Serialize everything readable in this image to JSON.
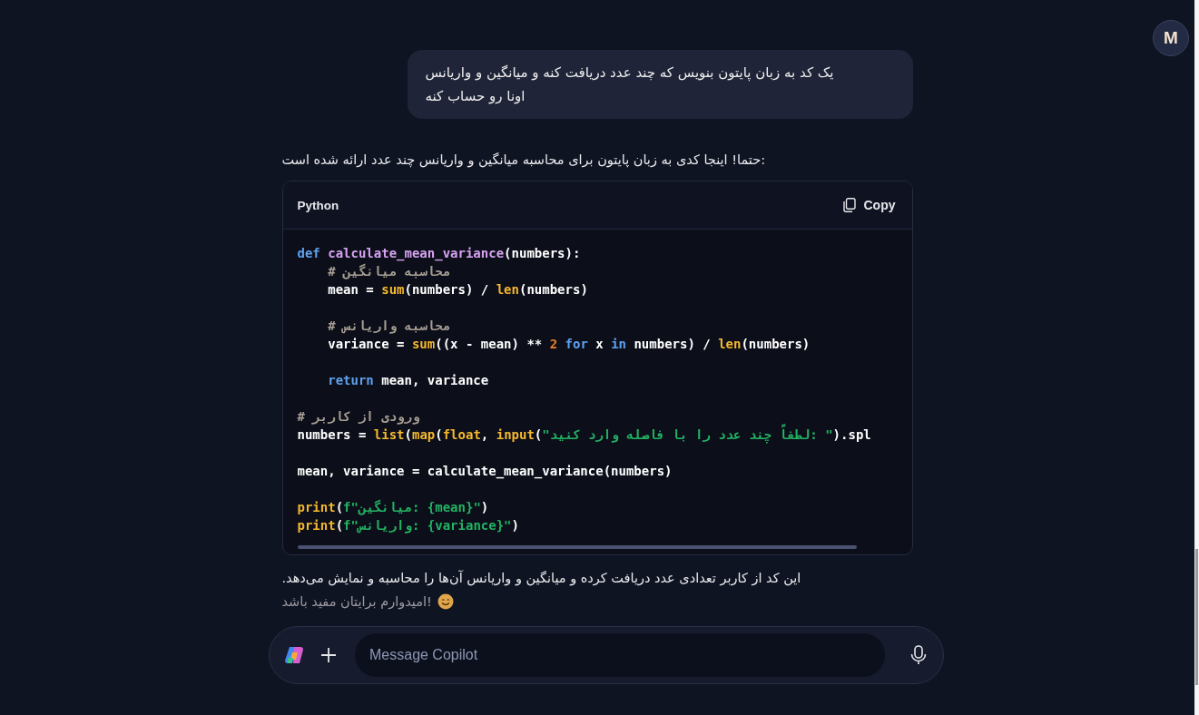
{
  "avatar": {
    "initial": "M"
  },
  "user_message": {
    "text": "یک کد به زبان پایتون بنویس که چند عدد دریافت کنه و میانگین و واریانس اونا رو حساب کنه"
  },
  "reply": {
    "intro": "حتما! اینجا کدی به زبان پایتون برای محاسبه میانگین و واریانس چند عدد ارائه شده است:",
    "code_block": {
      "language": "Python",
      "copy_label": "Copy",
      "lines": [
        {
          "kind": "code",
          "tokens": [
            {
              "t": "def ",
              "kind": "keyword"
            },
            {
              "t": "calculate_mean_variance",
              "kind": "function"
            },
            {
              "t": "(numbers):",
              "kind": "plain"
            }
          ]
        },
        {
          "kind": "code",
          "tokens": [
            {
              "t": "    # محاسبه میانگین",
              "kind": "comment"
            }
          ]
        },
        {
          "kind": "code",
          "tokens": [
            {
              "t": "    mean = ",
              "kind": "plain"
            },
            {
              "t": "sum",
              "kind": "builtin"
            },
            {
              "t": "(numbers) / ",
              "kind": "plain"
            },
            {
              "t": "len",
              "kind": "builtin"
            },
            {
              "t": "(numbers)",
              "kind": "plain"
            }
          ]
        },
        {
          "kind": "blank"
        },
        {
          "kind": "code",
          "tokens": [
            {
              "t": "    # محاسبه واریانس",
              "kind": "comment"
            }
          ]
        },
        {
          "kind": "code",
          "tokens": [
            {
              "t": "    variance = ",
              "kind": "plain"
            },
            {
              "t": "sum",
              "kind": "builtin"
            },
            {
              "t": "((x - mean) ** ",
              "kind": "plain"
            },
            {
              "t": "2",
              "kind": "number"
            },
            {
              "t": " for ",
              "kind": "keyword"
            },
            {
              "t": "x ",
              "kind": "plain"
            },
            {
              "t": "in",
              "kind": "keyword"
            },
            {
              "t": " numbers) / ",
              "kind": "plain"
            },
            {
              "t": "len",
              "kind": "builtin"
            },
            {
              "t": "(numbers)",
              "kind": "plain"
            }
          ]
        },
        {
          "kind": "blank"
        },
        {
          "kind": "code",
          "tokens": [
            {
              "t": "    return",
              "kind": "keyword"
            },
            {
              "t": " mean, variance",
              "kind": "plain"
            }
          ]
        },
        {
          "kind": "blank"
        },
        {
          "kind": "code",
          "tokens": [
            {
              "t": "# ورودی از کاربر",
              "kind": "comment"
            }
          ]
        },
        {
          "kind": "code",
          "tokens": [
            {
              "t": "numbers = ",
              "kind": "plain"
            },
            {
              "t": "list",
              "kind": "builtin"
            },
            {
              "t": "(",
              "kind": "plain"
            },
            {
              "t": "map",
              "kind": "builtin"
            },
            {
              "t": "(",
              "kind": "plain"
            },
            {
              "t": "float",
              "kind": "builtin"
            },
            {
              "t": ", ",
              "kind": "plain"
            },
            {
              "t": "input",
              "kind": "builtin"
            },
            {
              "t": "(",
              "kind": "plain"
            },
            {
              "t": "\"لطفاً چند عدد را با فاصله وارد کنید: \"",
              "kind": "string"
            },
            {
              "t": ").spl",
              "kind": "plain"
            }
          ]
        },
        {
          "kind": "blank"
        },
        {
          "kind": "code",
          "tokens": [
            {
              "t": "mean, variance = calculate_mean_variance(numbers)",
              "kind": "plain"
            }
          ]
        },
        {
          "kind": "blank"
        },
        {
          "kind": "code",
          "tokens": [
            {
              "t": "print",
              "kind": "builtin"
            },
            {
              "t": "(",
              "kind": "plain"
            },
            {
              "t": "f\"میانگین: {mean}\"",
              "kind": "string"
            },
            {
              "t": ")",
              "kind": "plain"
            }
          ]
        },
        {
          "kind": "code",
          "tokens": [
            {
              "t": "print",
              "kind": "builtin"
            },
            {
              "t": "(",
              "kind": "plain"
            },
            {
              "t": "f\"واریانس: {variance}\"",
              "kind": "string"
            },
            {
              "t": ")",
              "kind": "plain"
            }
          ]
        }
      ]
    },
    "summary": "این کد از کاربر تعدادی عدد دریافت کرده و میانگین و واریانس آن‌ها را محاسبه و نمایش می‌دهد.",
    "closing": "امیدوارم برایتان مفید باشد!"
  },
  "composer": {
    "placeholder": "Message Copilot"
  }
}
